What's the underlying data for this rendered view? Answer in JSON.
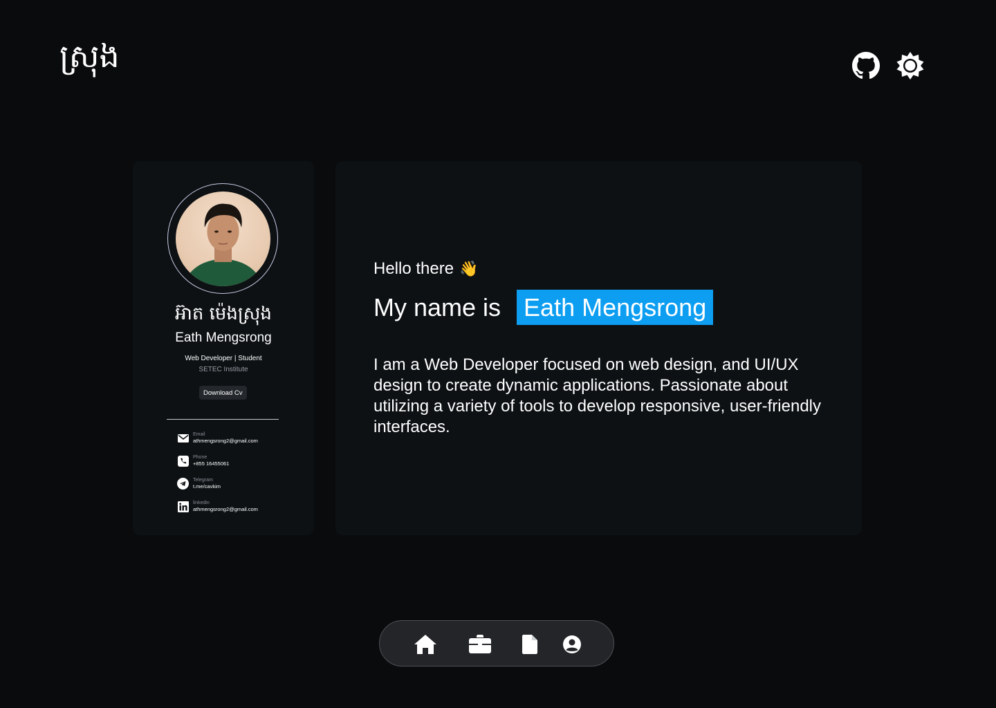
{
  "header": {
    "logo_text": "ស្រុង",
    "icons": [
      "github-icon",
      "sun-icon"
    ]
  },
  "profile": {
    "khmer_name": "អ៊ាត ម៉េងស្រុង",
    "name": "Eath Mengsrong",
    "role": "Web Developer | Student",
    "institute": "SETEC Institute",
    "download_label": "Download Cv",
    "contacts": [
      {
        "label": "Email",
        "value": "athmengsrong2@gmail.com",
        "icon": "mail-icon"
      },
      {
        "label": "Phone",
        "value": "+855 16455061",
        "icon": "phone-icon"
      },
      {
        "label": "Telegram",
        "value": "t.me/cavkim",
        "icon": "telegram-icon"
      },
      {
        "label": "linkedin",
        "value": "athmengsrong2@gmail.com",
        "icon": "linkedin-icon"
      }
    ]
  },
  "intro": {
    "greeting": "Hello there",
    "greeting_emoji": "👋",
    "name_prefix": "My name is",
    "name_highlight": "Eath Mengsrong",
    "bio": "I am a Web Developer  focused on web design, and UI/UX design to create dynamic applications. Passionate about utilizing a variety of tools to develop responsive, user-friendly interfaces."
  },
  "nav": {
    "items": [
      "home-icon",
      "briefcase-icon",
      "file-icon",
      "user-icon"
    ]
  },
  "colors": {
    "background": "#0a0b0d",
    "card": "#0d1114",
    "accent": "#0d9ef2",
    "nav_bg": "#232529"
  }
}
